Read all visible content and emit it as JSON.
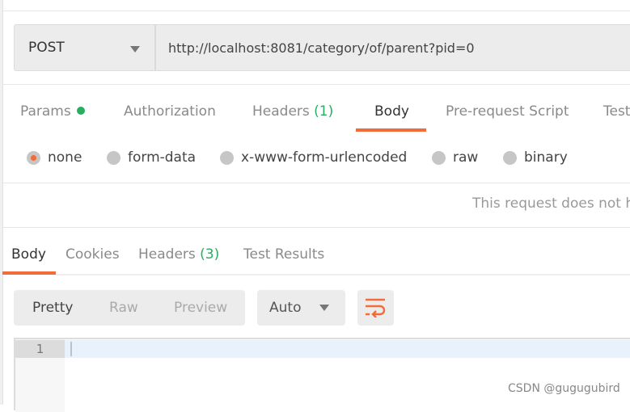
{
  "request": {
    "method": "POST",
    "url": "http://localhost:8081/category/of/parent?pid=0"
  },
  "request_tabs": [
    {
      "label": "Params",
      "dot": true
    },
    {
      "label": "Authorization"
    },
    {
      "label": "Headers",
      "count": "(1)"
    },
    {
      "label": "Body",
      "active": true
    },
    {
      "label": "Pre-request Script"
    },
    {
      "label": "Test"
    }
  ],
  "body_types": [
    {
      "label": "none",
      "selected": true
    },
    {
      "label": "form-data"
    },
    {
      "label": "x-www-form-urlencoded"
    },
    {
      "label": "raw"
    },
    {
      "label": "binary"
    }
  ],
  "body_note": "This request does not h",
  "response_tabs": [
    {
      "label": "Body",
      "active": true
    },
    {
      "label": "Cookies"
    },
    {
      "label": "Headers",
      "count": "(3)"
    },
    {
      "label": "Test Results"
    }
  ],
  "view_modes": [
    "Pretty",
    "Raw",
    "Preview"
  ],
  "format_select": "Auto",
  "editor": {
    "line_numbers": [
      "1"
    ]
  },
  "watermark": "CSDN @gugugubird",
  "colors": {
    "accent": "#f26b3a",
    "green": "#27ae60"
  },
  "icons": {
    "wrap": "wrap-lines-icon"
  }
}
